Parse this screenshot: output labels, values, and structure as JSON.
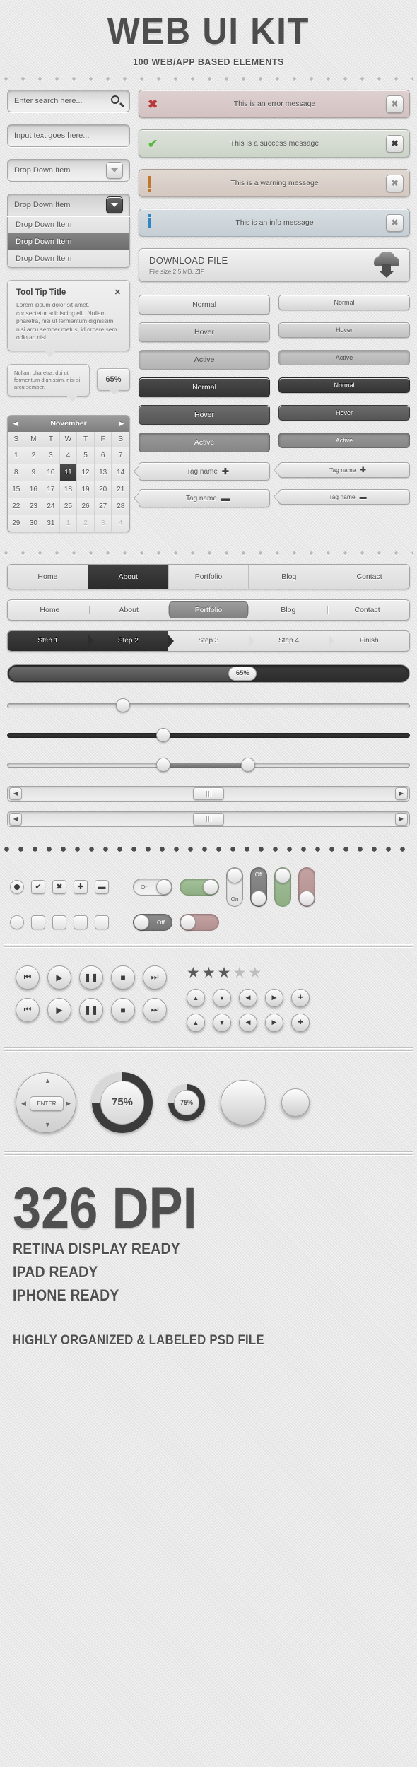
{
  "header": {
    "title": "WEB UI KIT",
    "subtitle": "100 WEB/APP BASED ELEMENTS"
  },
  "forms": {
    "search_placeholder": "Enter search here...",
    "input_placeholder": "Input text goes here...",
    "dropdown_value": "Drop Down Item",
    "dropdown_open_value": "Drop Down Item",
    "dropdown_options": [
      "Drop Down Item",
      "Drop Down Item",
      "Drop Down Item"
    ],
    "selected_option_index": 1
  },
  "tooltip": {
    "title": "Tool Tip Title",
    "close": "✕",
    "body": "Lorem ipsum dolor sit amet, consectetur adipiscing elit. Nullam pharetra, nisi ut fermentum dignissim, nisi arcu semper metus, id ornare sem odio ac nisl.",
    "small_body": "Nullam pharetra, dui ut fermentum dignissim, nisi si arcu semper.",
    "percent_badge": "65%"
  },
  "calendar": {
    "month": "November",
    "prev": "◀",
    "next": "▶",
    "dow": [
      "S",
      "M",
      "T",
      "W",
      "T",
      "F",
      "S"
    ],
    "weeks": [
      [
        {
          "d": "1"
        },
        {
          "d": "2"
        },
        {
          "d": "3"
        },
        {
          "d": "4"
        },
        {
          "d": "5"
        },
        {
          "d": "6"
        },
        {
          "d": "7"
        }
      ],
      [
        {
          "d": "8"
        },
        {
          "d": "9"
        },
        {
          "d": "10"
        },
        {
          "d": "11",
          "today": true
        },
        {
          "d": "12"
        },
        {
          "d": "13"
        },
        {
          "d": "14"
        }
      ],
      [
        {
          "d": "15"
        },
        {
          "d": "16"
        },
        {
          "d": "17"
        },
        {
          "d": "18"
        },
        {
          "d": "19"
        },
        {
          "d": "20"
        },
        {
          "d": "21"
        }
      ],
      [
        {
          "d": "22"
        },
        {
          "d": "23"
        },
        {
          "d": "24"
        },
        {
          "d": "25"
        },
        {
          "d": "26"
        },
        {
          "d": "27"
        },
        {
          "d": "28"
        }
      ],
      [
        {
          "d": "29"
        },
        {
          "d": "30"
        },
        {
          "d": "31"
        },
        {
          "d": "1",
          "mut": true
        },
        {
          "d": "2",
          "mut": true
        },
        {
          "d": "3",
          "mut": true
        },
        {
          "d": "4",
          "mut": true
        }
      ]
    ]
  },
  "alerts": [
    {
      "type": "error",
      "text": "This is an error message",
      "icon": "error-x-icon",
      "close": "✖",
      "color": "#b8393a"
    },
    {
      "type": "success",
      "text": "This is a success message",
      "icon": "success-check-icon",
      "close": "✖",
      "color": "#57b83c"
    },
    {
      "type": "warning",
      "text": "This is a warning message",
      "icon": "warning-bang-icon",
      "close": "✖",
      "color": "#c2762a"
    },
    {
      "type": "info",
      "text": "This is an info message",
      "icon": "info-i-icon",
      "close": "✖",
      "color": "#2e86c4"
    }
  ],
  "download": {
    "title": "DOWNLOAD FILE",
    "meta": "File size  2.5 MB, ZIP",
    "icon": "cloud-download-icon"
  },
  "buttons": {
    "light": [
      {
        "label": "Normal",
        "state": "normal"
      },
      {
        "label": "Hover",
        "state": "hover"
      },
      {
        "label": "Active",
        "state": "active"
      }
    ],
    "light_small": [
      {
        "label": "Normal",
        "state": "normal"
      },
      {
        "label": "Hover",
        "state": "hover"
      },
      {
        "label": "Active",
        "state": "active"
      }
    ],
    "dark": [
      {
        "label": "Normal",
        "state": "normal"
      },
      {
        "label": "Hover",
        "state": "hover"
      },
      {
        "label": "Active",
        "state": "active"
      }
    ],
    "dark_small": [
      {
        "label": "Normal",
        "state": "normal"
      },
      {
        "label": "Hover",
        "state": "hover"
      },
      {
        "label": "Active",
        "state": "active"
      }
    ]
  },
  "tags": [
    {
      "label": "Tag name",
      "sym": "✚"
    },
    {
      "label": "Tag name",
      "sym": "✚"
    },
    {
      "label": "Tag name",
      "sym": "▬"
    },
    {
      "label": "Tag name",
      "sym": "▬"
    }
  ],
  "nav": {
    "tabs": [
      {
        "label": "Home",
        "active": false
      },
      {
        "label": "About",
        "active": true
      },
      {
        "label": "Portfolio",
        "active": false
      },
      {
        "label": "Blog",
        "active": false
      },
      {
        "label": "Contact",
        "active": false
      }
    ],
    "pills": [
      {
        "label": "Home",
        "active": false
      },
      {
        "label": "About",
        "active": false
      },
      {
        "label": "Portfolio",
        "active": true
      },
      {
        "label": "Blog",
        "active": false
      },
      {
        "label": "Contact",
        "active": false
      }
    ],
    "steps": [
      {
        "label": "Step 1",
        "active": true
      },
      {
        "label": "Step 2",
        "active": true
      },
      {
        "label": "Step 3",
        "active": false
      },
      {
        "label": "Step 4",
        "active": false
      },
      {
        "label": "Finish",
        "active": false
      }
    ]
  },
  "progress": {
    "value": "65%",
    "fill_percent": 58
  },
  "sliders": [
    {
      "type": "single-light",
      "handle_percent": 27
    },
    {
      "type": "single-dark",
      "handle_percent": 37
    },
    {
      "type": "range",
      "from_percent": 37,
      "to_percent": 58
    }
  ],
  "scrollbars": [
    {
      "left": "◀",
      "right": "▶",
      "thumb_percent": 46
    },
    {
      "left": "◀",
      "right": "▶",
      "thumb_percent": 46
    }
  ],
  "controls": {
    "checks": [
      "radio-selected",
      "checkbox-check",
      "checkbox-x",
      "checkbox-plus",
      "checkbox-minus"
    ],
    "checks_empty": [
      "radio-empty",
      "checkbox-empty",
      "checkbox-empty",
      "checkbox-empty",
      "checkbox-empty"
    ],
    "toggles": [
      {
        "label": "On",
        "state": "on",
        "color": "plain"
      },
      {
        "label": "Off",
        "state": "off",
        "color": "plain"
      },
      {
        "label": "",
        "state": "on",
        "color": "green"
      },
      {
        "label": "",
        "state": "off",
        "color": "red"
      }
    ],
    "vtoggles": [
      {
        "label": "On",
        "state": "top",
        "color": "plain"
      },
      {
        "label": "Off",
        "state": "bottom",
        "color": "grey"
      },
      {
        "label": "",
        "state": "top",
        "color": "green"
      },
      {
        "label": "",
        "state": "bottom",
        "color": "red"
      }
    ]
  },
  "media": {
    "row1": [
      "⏮",
      "▶",
      "❚❚",
      "■",
      "⏭"
    ],
    "row2": [
      "⏮",
      "▶",
      "❚❚",
      "■",
      "⏭"
    ],
    "arrows_row1": [
      "▲",
      "▼",
      "◀",
      "▶",
      "✚"
    ],
    "arrows_row2": [
      "▲",
      "▼",
      "◀",
      "▶",
      "✚"
    ],
    "rating": {
      "filled": 3,
      "total": 5,
      "star": "★"
    }
  },
  "knobs": {
    "dpad_label": "ENTER",
    "dpad_arrows": [
      "▲",
      "▼",
      "◀",
      "▶"
    ],
    "big_value": "75%",
    "small_value": "75%"
  },
  "footer": {
    "dpi": "326 DPI",
    "lines": [
      "RETINA DISPLAY READY",
      "IPAD READY",
      "IPHONE READY"
    ],
    "psd": "HIGHLY ORGANIZED & LABELED PSD FILE"
  }
}
